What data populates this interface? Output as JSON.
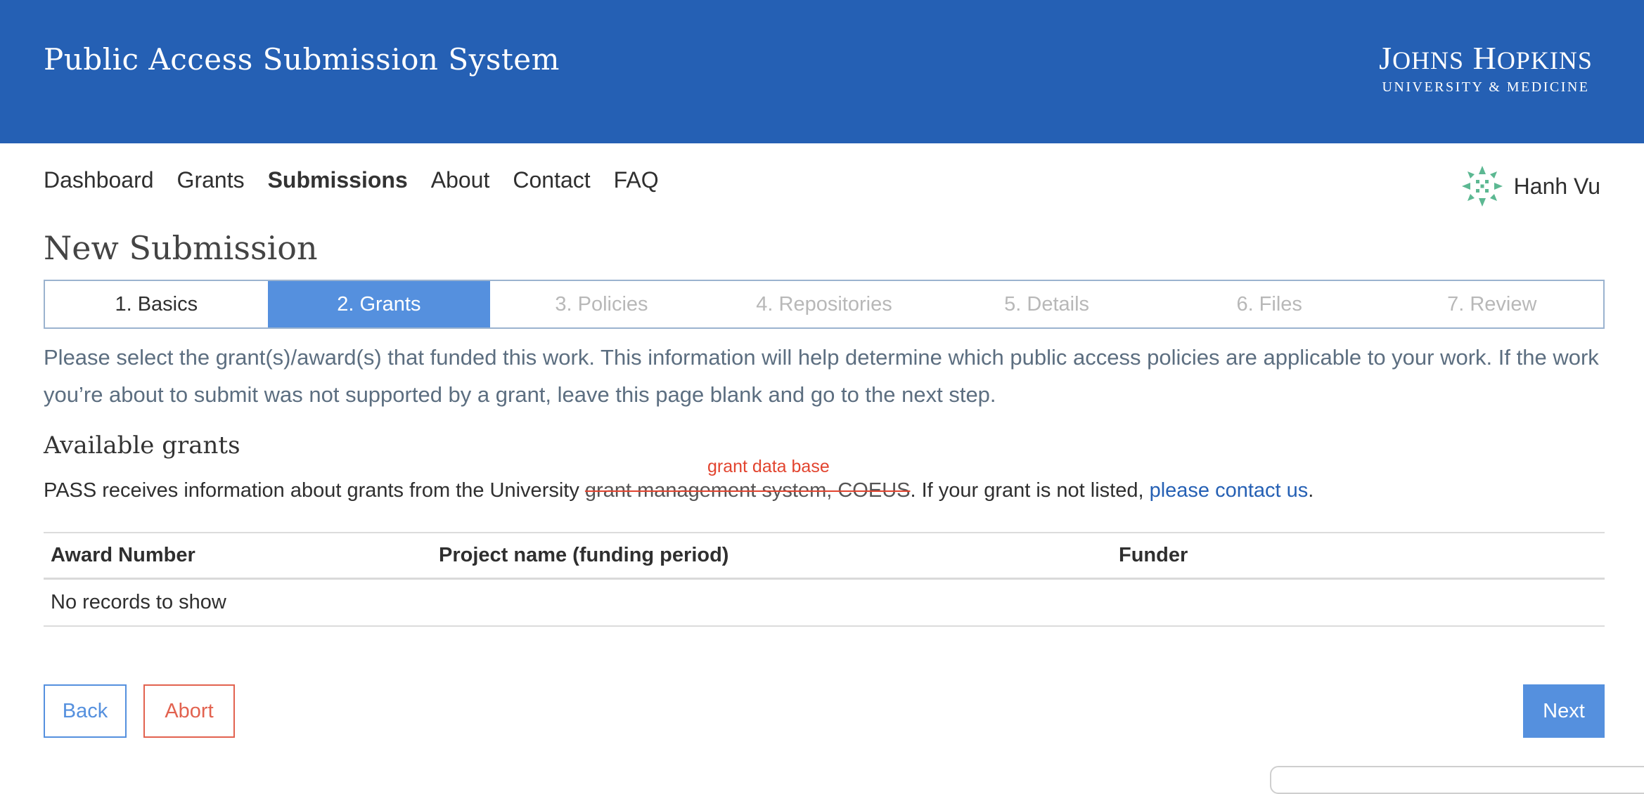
{
  "header": {
    "app_title": "Public Access Submission System",
    "logo_main": "JOHNS HOPKINS",
    "logo_sub": "UNIVERSITY & MEDICINE",
    "background_color": "#2560b4"
  },
  "nav": {
    "items": [
      {
        "label": "Dashboard"
      },
      {
        "label": "Grants"
      },
      {
        "label": "Submissions"
      },
      {
        "label": "About"
      },
      {
        "label": "Contact"
      },
      {
        "label": "FAQ"
      }
    ],
    "active": "Submissions"
  },
  "user": {
    "name": "Hanh Vu",
    "avatar_icon": "identicon-avatar",
    "avatar_color": "#5cb892"
  },
  "page": {
    "title": "New Submission"
  },
  "steps": {
    "items": [
      {
        "label": "1. Basics",
        "state": "done"
      },
      {
        "label": "2. Grants",
        "state": "active"
      },
      {
        "label": "3. Policies",
        "state": "pending"
      },
      {
        "label": "4. Repositories",
        "state": "pending"
      },
      {
        "label": "5. Details",
        "state": "pending"
      },
      {
        "label": "6. Files",
        "state": "pending"
      },
      {
        "label": "7. Review",
        "state": "pending"
      }
    ],
    "active_color": "#5590de"
  },
  "intro": {
    "text": "Please select the grant(s)/award(s) that funded this work. This information will help determine which public access policies are applicable to your work. If the work you’re about to submit was not supported by a grant, leave this page blank and go to the next step."
  },
  "grants": {
    "section_title": "Available grants",
    "annotation": "grant data base",
    "source_prefix": "PASS receives information about grants from the University ",
    "source_struck": "grant management system, COEUS",
    "source_suffix": ". If your grant is not listed, ",
    "contact_link": "please contact us",
    "source_end": ".",
    "table": {
      "columns": [
        "Award Number",
        "Project name (funding period)",
        "Funder"
      ],
      "empty_message": "No records to show"
    }
  },
  "actions": {
    "back_label": "Back",
    "abort_label": "Abort",
    "next_label": "Next"
  }
}
